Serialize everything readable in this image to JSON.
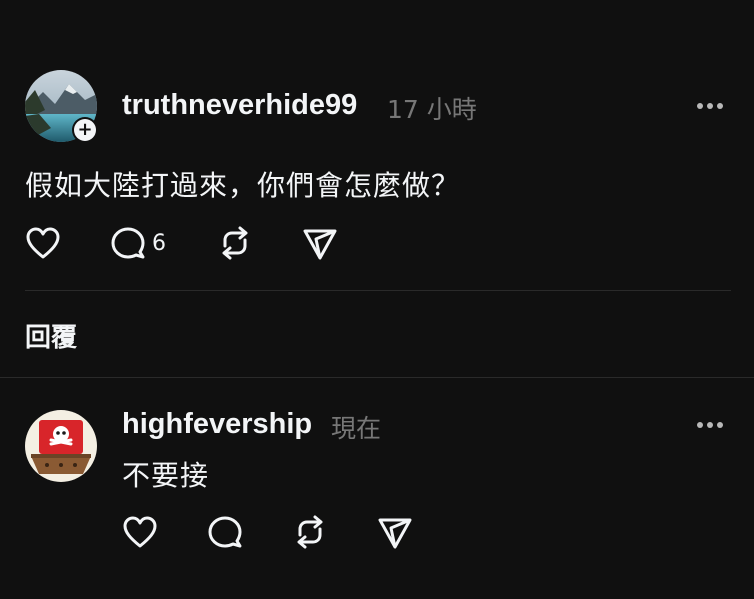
{
  "post": {
    "username": "truthneverhide99",
    "timestamp": "17 小時",
    "text": "假如大陸打過來，你們會怎麼做？",
    "reply_count": "6"
  },
  "replies_section": {
    "label": "回覆"
  },
  "reply": {
    "username": "highfevership",
    "timestamp": "現在",
    "text": "不要接"
  },
  "colors": {
    "background": "#101010",
    "text_primary": "#f3f5f7",
    "text_secondary": "#777777",
    "divider": "#2a2a2a"
  },
  "icons": {
    "like": "heart-icon",
    "comment": "comment-bubble-icon",
    "repost": "repost-icon",
    "share": "share-send-icon",
    "more": "more-dots-icon",
    "follow": "plus-icon"
  }
}
